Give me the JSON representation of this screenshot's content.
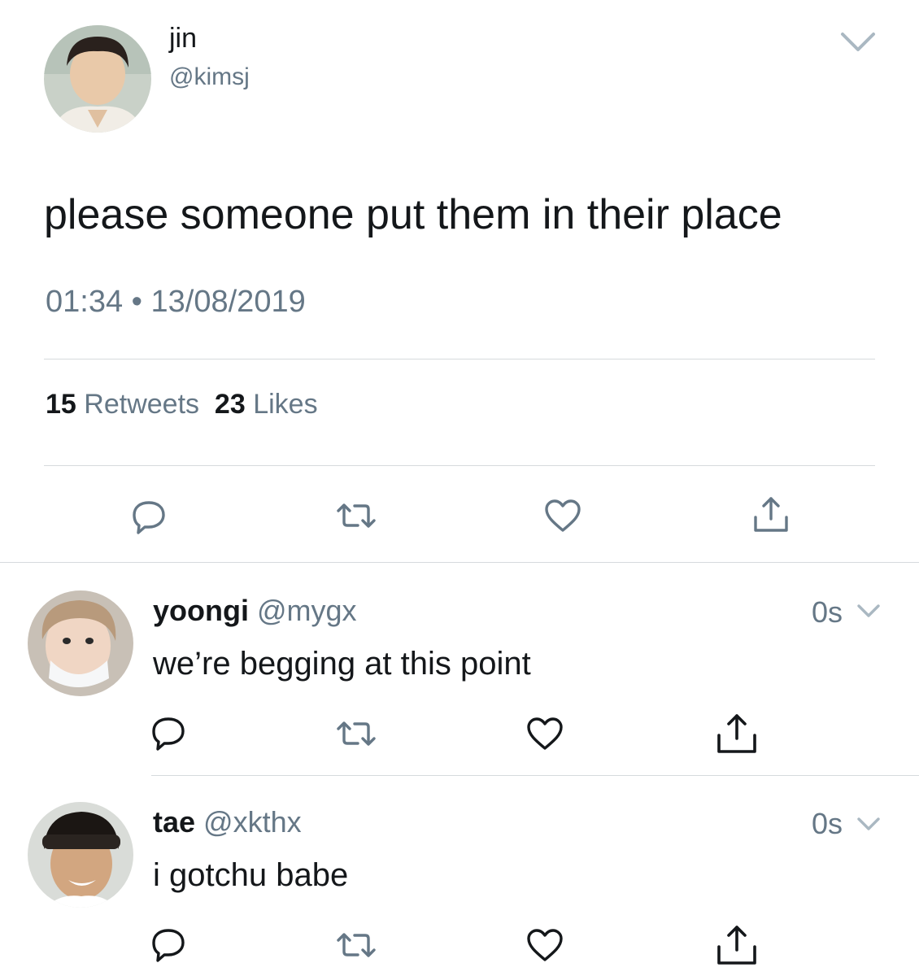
{
  "main": {
    "name": "jin",
    "handle": "@kimsj",
    "text": "please someone put them in their place",
    "time": "01:34",
    "separator": "•",
    "date": "13/08/2019",
    "retweets_count": "15",
    "retweets_label": "Retweets",
    "likes_count": "23",
    "likes_label": "Likes"
  },
  "replies": [
    {
      "name": "yoongi",
      "handle": "@mygx",
      "text": "we’re begging at this point",
      "time": "0s"
    },
    {
      "name": "tae",
      "handle": "@xkthx",
      "text": "i gotchu babe",
      "time": "0s"
    }
  ],
  "colors": {
    "text": "#14171a",
    "muted": "#657786",
    "divider": "#d6dadd"
  },
  "icons": [
    "chevron-down-icon",
    "reply-icon",
    "retweet-icon",
    "heart-icon",
    "share-icon"
  ]
}
